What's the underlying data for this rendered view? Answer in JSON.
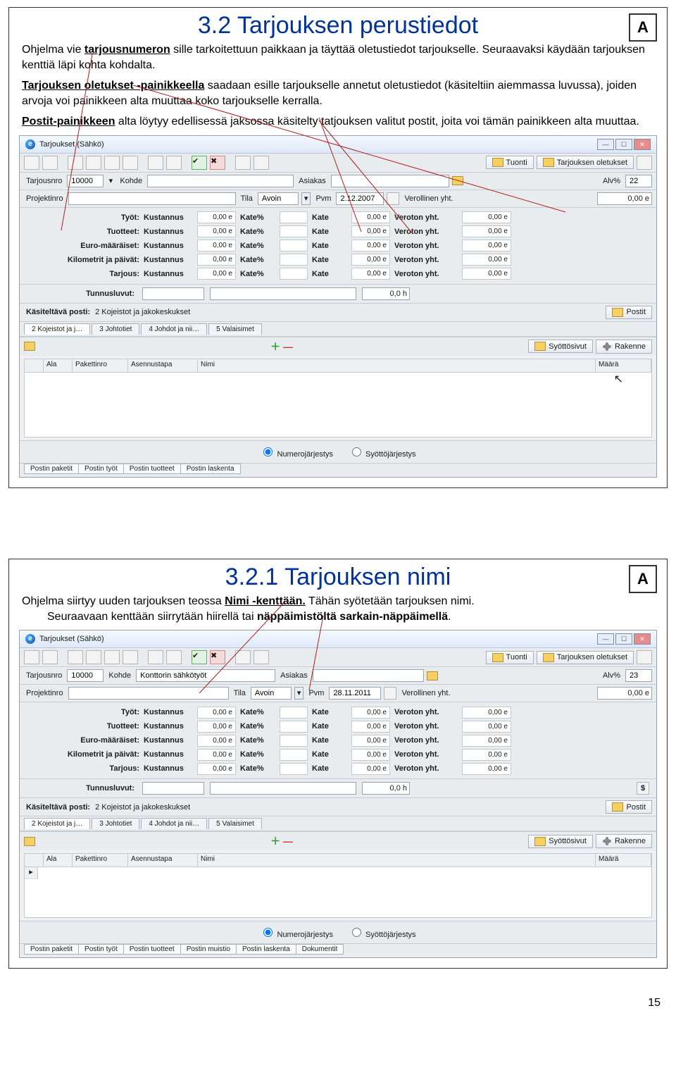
{
  "slide1": {
    "title": "3.2 Tarjouksen perustiedot",
    "logo": "A",
    "para1_a": "Ohjelma vie ",
    "para1_u": "tarjousnumeron",
    "para1_b": " sille tarkoitettuun paikkaan ja täyttää oletustiedot tarjoukselle. Seuraavaksi käydään tarjouksen kenttiä läpi kohta kohdalta.",
    "para2_u": "Tarjouksen oletukset -painikkeella",
    "para2_b": " saadaan esille tarjoukselle annetut oletustiedot (käsiteltiin aiemmassa luvussa), joiden arvoja voi painikkeen alta muuttaa koko tarjoukselle kerralla.",
    "para3_u": "Postit-painikkeen",
    "para3_b": " alta löytyy edellisessä jaksossa käsitelty tatjouksen valitut postit, joita voi tämän painikkeen alta muuttaa."
  },
  "win1": {
    "title": "Tarjoukset (Sähkö)",
    "tuonti": "Tuonti",
    "oletukset": "Tarjouksen oletukset",
    "tarjousnro_lbl": "Tarjousnro",
    "tarjousnro_val": "10000",
    "kohde_lbl": "Kohde",
    "asiakas_lbl": "Asiakas",
    "alv_lbl": "Alv%",
    "alv_val": "22",
    "proj_lbl": "Projektinro",
    "tila_lbl": "Tila",
    "tila_val": "Avoin",
    "pvm_lbl": "Pvm",
    "pvm_val": "2.12.2007",
    "verollinen_lbl": "Verollinen yht.",
    "zero": "0,00 e",
    "rows": [
      {
        "l": "Työt:",
        "c": "Kustannus",
        "k": "Kate%",
        "kv": "Kate",
        "ve": "Veroton yht."
      },
      {
        "l": "Tuotteet:",
        "c": "Kustannus",
        "k": "Kate%",
        "kv": "Kate",
        "ve": "Veroton yht."
      },
      {
        "l": "Euro-määräiset:",
        "c": "Kustannus",
        "k": "Kate%",
        "kv": "Kate",
        "ve": "Veroton yht."
      },
      {
        "l": "Kilometrit ja päivät:",
        "c": "Kustannus",
        "k": "Kate%",
        "kv": "Kate",
        "ve": "Veroton yht."
      },
      {
        "l": "Tarjous:",
        "c": "Kustannus",
        "k": "Kate%",
        "kv": "Kate",
        "ve": "Veroton yht.",
        "bold": true
      }
    ],
    "tunnus_lbl": "Tunnusluvut:",
    "tunnus_h": "0,0 h",
    "kposti_lbl": "Käsiteltävä posti:",
    "kposti_val": "2 Kojeistot ja jakokeskukset",
    "postit_btn": "Postit",
    "tabs": [
      "2 Kojeistot ja j…",
      "3 Johtotiet",
      "4 Johdot ja nii…",
      "5 Valaisimet"
    ],
    "syotto": "Syöttösivut",
    "rakenne": "Rakenne",
    "th": [
      "",
      "Ala",
      "Pakettinro",
      "Asennustapa",
      "Nimi",
      "Määrä"
    ],
    "rad1": "Numerojärjestys",
    "rad2": "Syöttöjärjestys",
    "btabs": [
      "Postin paketit",
      "Postin työt",
      "Postin tuotteet",
      "Postin laskenta"
    ]
  },
  "slide2": {
    "title": "3.2.1 Tarjouksen nimi",
    "logo": "A",
    "p1a": "Ohjelma siirtyy uuden tarjouksen teossa ",
    "p1u": "Nimi -kenttään.",
    "p1b": " Tähän syötetään tarjouksen nimi.",
    "p2a": "Seuraavaan kenttään siirrytään hiirellä tai ",
    "p2b": "näppäimistöltä sarkain-näppäimellä",
    "p2c": "."
  },
  "win2": {
    "title": "Tarjoukset (Sähkö)",
    "kohde_val": "Konttorin sähkötyöt",
    "alv_val": "23",
    "pvm_val": "28.11.2011",
    "btabs": [
      "Postin paketit",
      "Postin työt",
      "Postin tuotteet",
      "Postin muistio",
      "Postin laskenta",
      "Dokumentit"
    ]
  },
  "pagenum": "15"
}
